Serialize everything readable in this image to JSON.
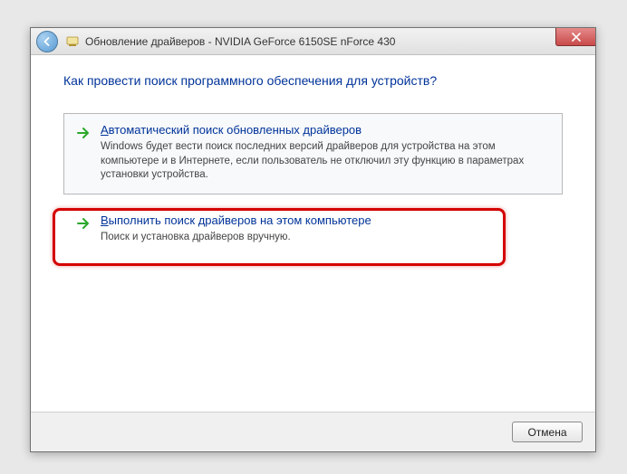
{
  "window": {
    "title": "Обновление драйверов - NVIDIA GeForce 6150SE nForce 430"
  },
  "headline": "Как провести поиск программного обеспечения для устройств?",
  "options": {
    "auto": {
      "title": "Автоматический поиск обновленных драйверов",
      "desc": "Windows будет вести поиск последних версий драйверов для устройства на этом компьютере и в Интернете, если пользователь не отключил эту функцию в параметрах установки устройства."
    },
    "manual": {
      "title": "Выполнить поиск драйверов на этом компьютере",
      "desc": "Поиск и установка драйверов вручную."
    }
  },
  "buttons": {
    "cancel": "Отмена"
  }
}
